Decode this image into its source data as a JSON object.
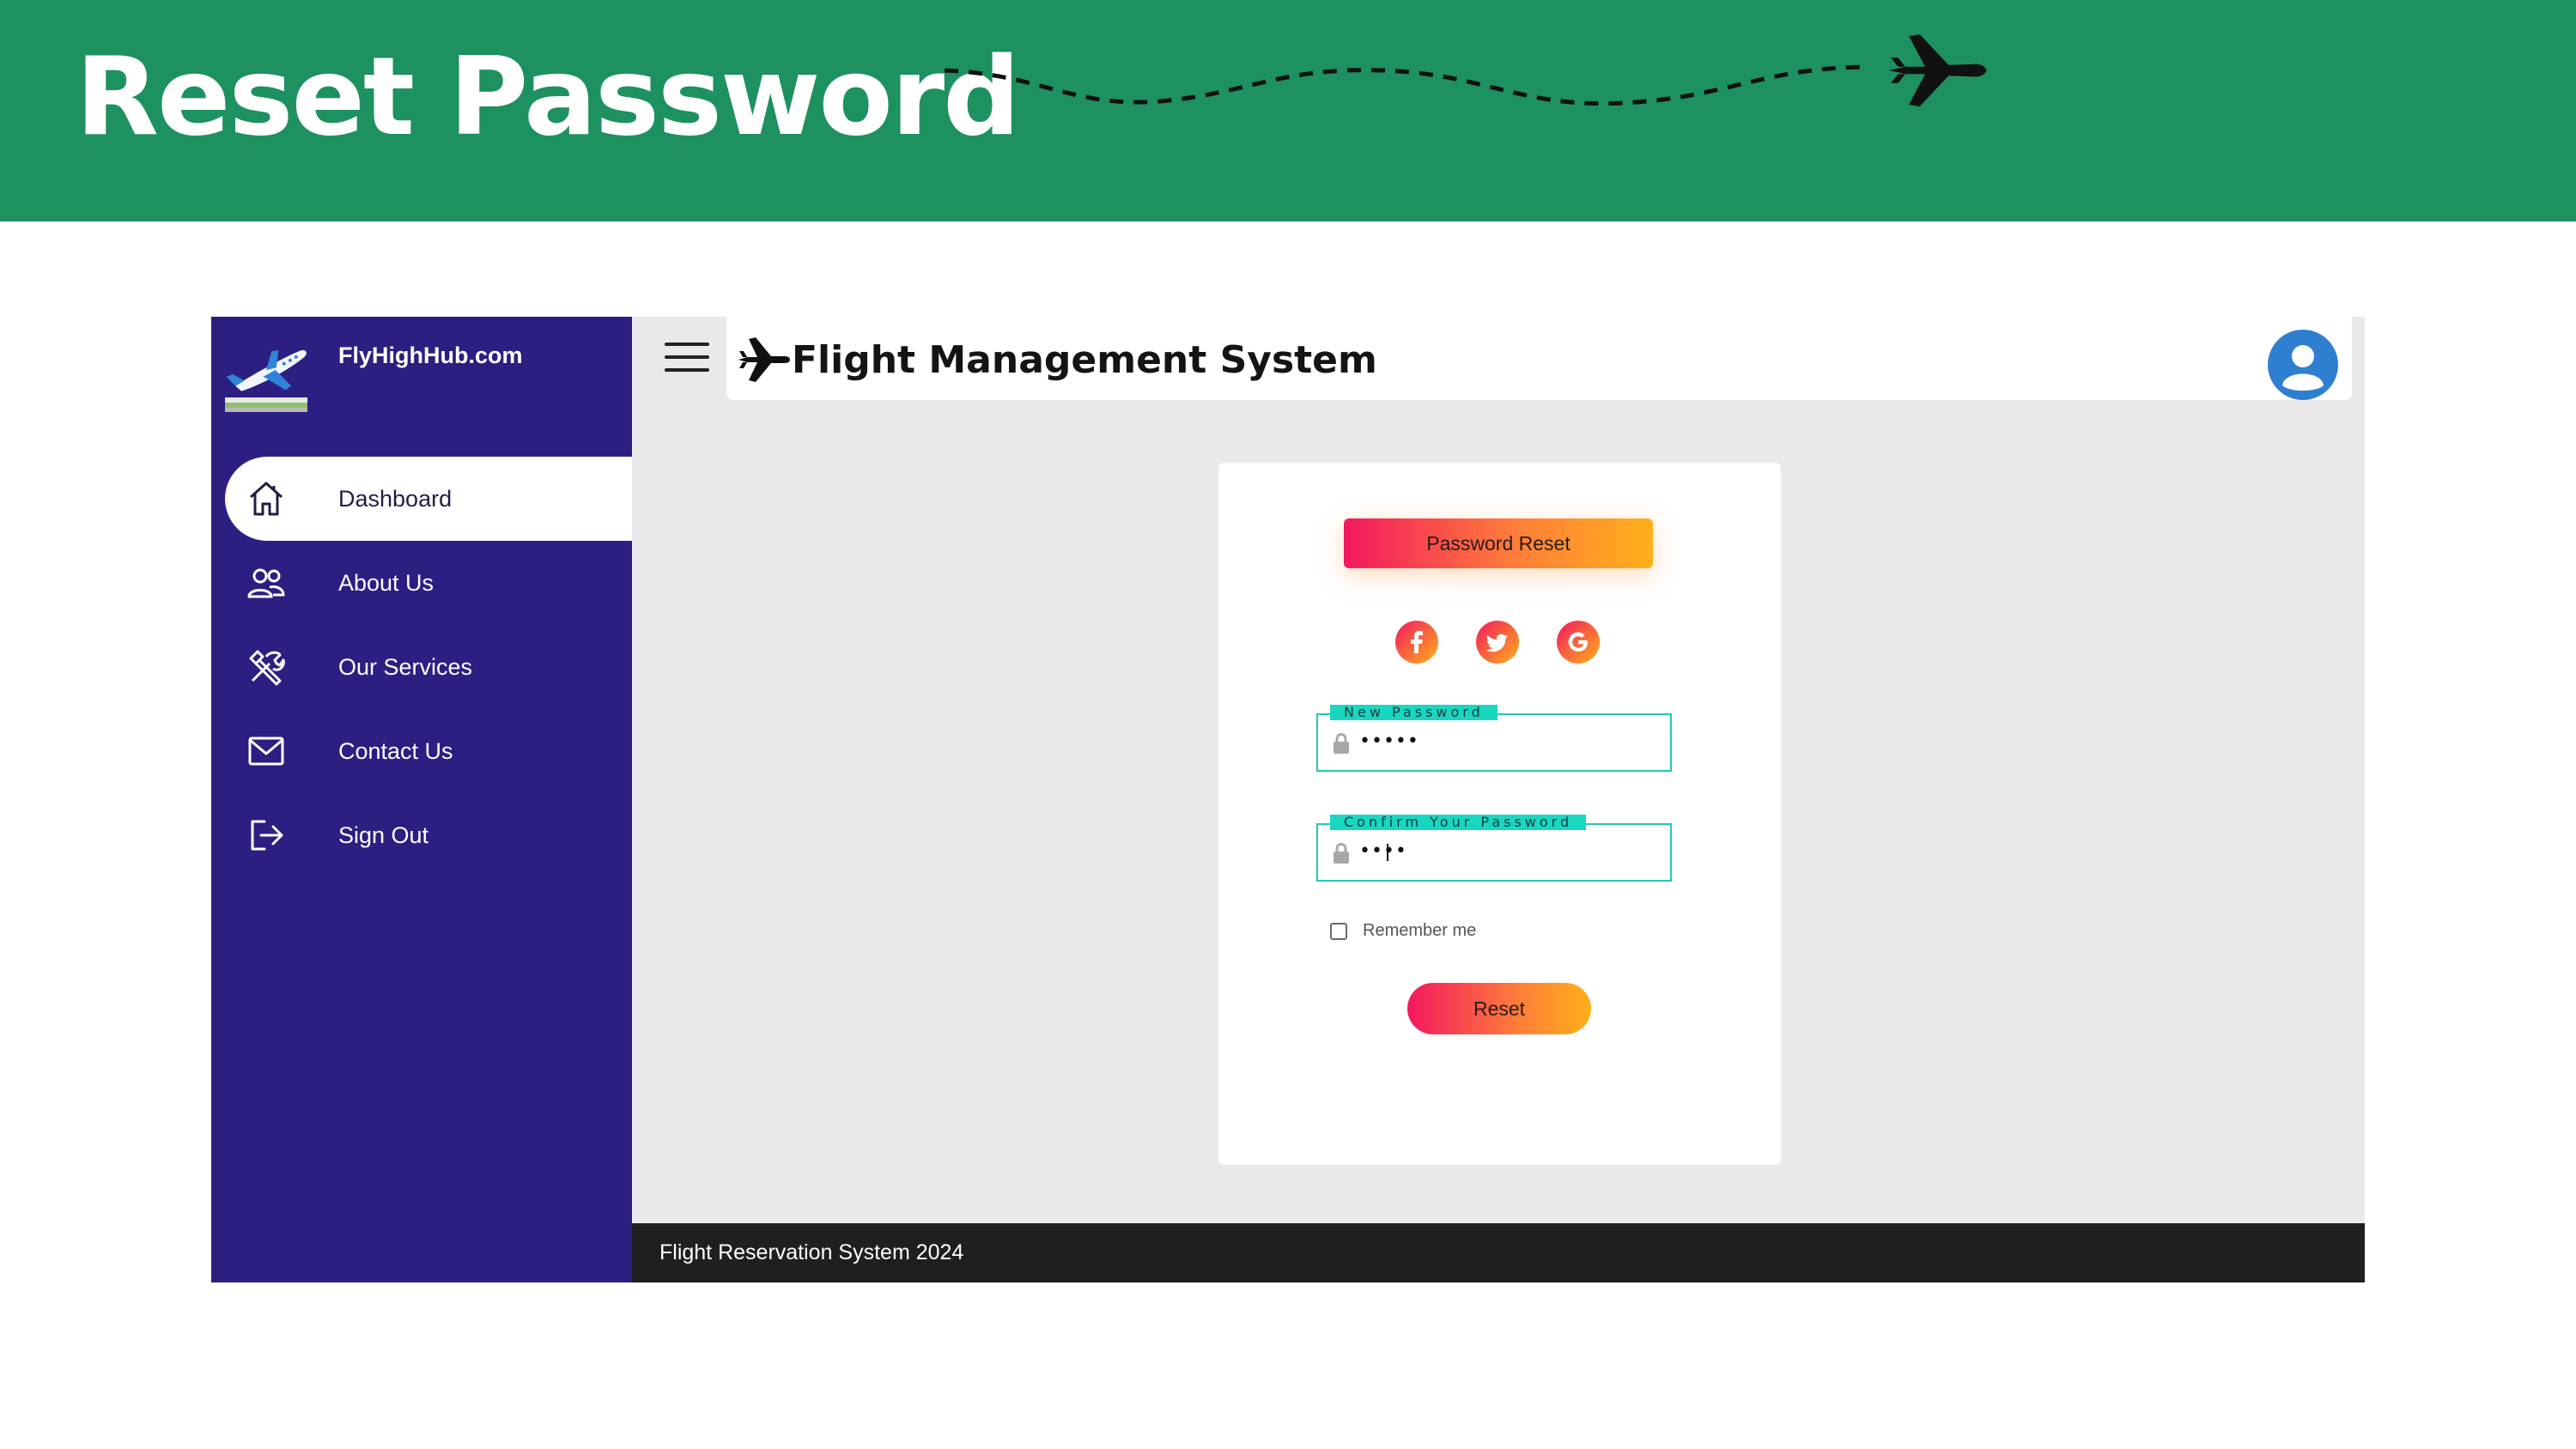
{
  "banner": {
    "title": "Reset Password"
  },
  "brand": {
    "name": "FlyHighHub.com"
  },
  "sidebar": {
    "items": [
      {
        "label": "Dashboard",
        "icon": "home-icon",
        "active": true
      },
      {
        "label": "About Us",
        "icon": "users-icon",
        "active": false
      },
      {
        "label": "Our Services",
        "icon": "tools-icon",
        "active": false
      },
      {
        "label": "Contact Us",
        "icon": "mail-icon",
        "active": false
      },
      {
        "label": "Sign Out",
        "icon": "sign-out-icon",
        "active": false
      }
    ]
  },
  "header": {
    "title": "Flight Management System"
  },
  "card": {
    "title": "Password Reset",
    "socials": [
      "facebook-icon",
      "twitter-icon",
      "google-icon"
    ],
    "new_password": {
      "label": "New Password",
      "value": "•••••"
    },
    "confirm_password": {
      "label": "Confirm Your Password",
      "value": "••••"
    },
    "remember_label": "Remember me",
    "remember_checked": false,
    "reset_label": "Reset"
  },
  "footer": {
    "text": "Flight Reservation System 2024"
  },
  "colors": {
    "banner": "#1d9160",
    "sidebar": "#2b1f82",
    "accent_start": "#f2185f",
    "accent_end": "#ffb01a",
    "field_border": "#22c9b4"
  }
}
